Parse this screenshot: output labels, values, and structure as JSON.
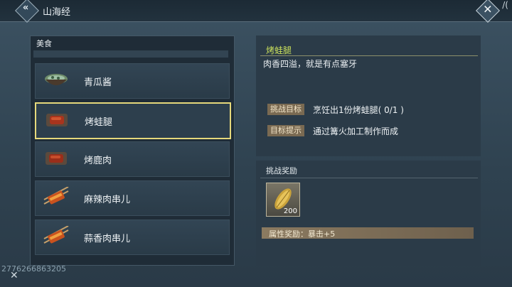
{
  "header": {
    "title": "山海经",
    "corner_label": "/("
  },
  "list": {
    "section_label": "美食",
    "items": [
      {
        "label": "青瓜酱",
        "icon": "bowl-icon",
        "selected": false
      },
      {
        "label": "烤蛙腿",
        "icon": "roast-meat-icon",
        "selected": true
      },
      {
        "label": "烤鹿肉",
        "icon": "roast-meat-icon",
        "selected": false
      },
      {
        "label": "麻辣肉串儿",
        "icon": "skewer-icon",
        "selected": false
      },
      {
        "label": "蒜香肉串儿",
        "icon": "skewer-icon",
        "selected": false
      }
    ]
  },
  "detail": {
    "name": "烤蛙腿",
    "description": "肉香四溢，就是有点塞牙",
    "goal_tag": "挑战目标",
    "goal_value": "烹饪出1份烤蛙腿( 0/1 )",
    "hint_tag": "目标提示",
    "hint_value": "通过篝火加工制作而成"
  },
  "reward": {
    "title": "挑战奖励",
    "item_count": "200",
    "item_icon": "grain-icon",
    "attr_text": "属性奖励：暴击+5"
  },
  "footer": {
    "user_id": "2776266863205"
  },
  "colors": {
    "accent": "#e6d97b",
    "name_color": "#c9df5b",
    "tag_bg": "#7a6a52"
  }
}
